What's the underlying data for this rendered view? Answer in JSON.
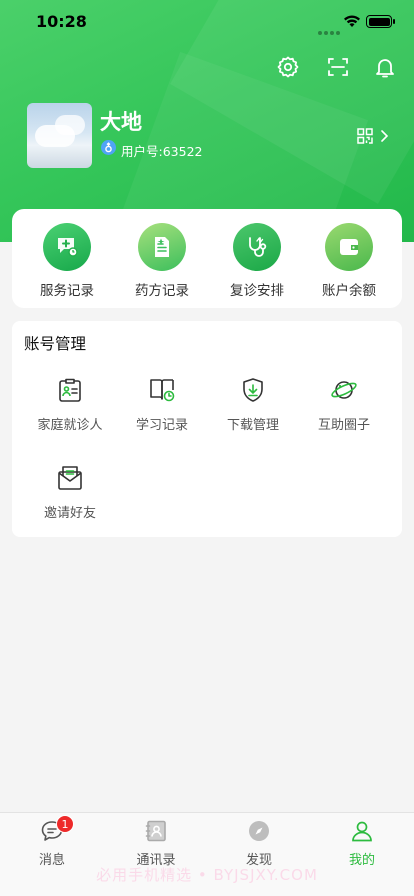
{
  "status_bar": {
    "time": "10:28"
  },
  "profile": {
    "name": "大地",
    "user_id": "用户号:63522"
  },
  "services": [
    {
      "label": "服务记录",
      "icon": "service-record-icon",
      "color_from": "#4bd173",
      "color_to": "#17a84a"
    },
    {
      "label": "药方记录",
      "icon": "prescription-icon",
      "color_from": "#a7e07d",
      "color_to": "#3cbf5c"
    },
    {
      "label": "复诊安排",
      "icon": "stethoscope-icon",
      "color_from": "#4cc76c",
      "color_to": "#1ba847"
    },
    {
      "label": "账户余额",
      "icon": "wallet-icon",
      "color_from": "#9ad970",
      "color_to": "#4ab84c"
    }
  ],
  "account": {
    "title": "账号管理",
    "items": [
      {
        "label": "家庭就诊人",
        "icon": "family-patient-icon"
      },
      {
        "label": "学习记录",
        "icon": "study-record-icon"
      },
      {
        "label": "下载管理",
        "icon": "download-manage-icon"
      },
      {
        "label": "互助圈子",
        "icon": "planet-icon"
      },
      {
        "label": "邀请好友",
        "icon": "invite-mail-icon"
      }
    ]
  },
  "tab_bar": {
    "tabs": [
      {
        "label": "消息",
        "icon": "message-icon",
        "badge": "1"
      },
      {
        "label": "通讯录",
        "icon": "contacts-icon"
      },
      {
        "label": "发现",
        "icon": "compass-icon"
      },
      {
        "label": "我的",
        "icon": "profile-icon",
        "active": true
      }
    ]
  },
  "watermark": "必用手机精选 • BYJSJXY.COM",
  "colors": {
    "accent": "#2dbb3f",
    "header_from": "#4bd06a",
    "header_to": "#22b84a",
    "badge": "#ee2a2a"
  }
}
